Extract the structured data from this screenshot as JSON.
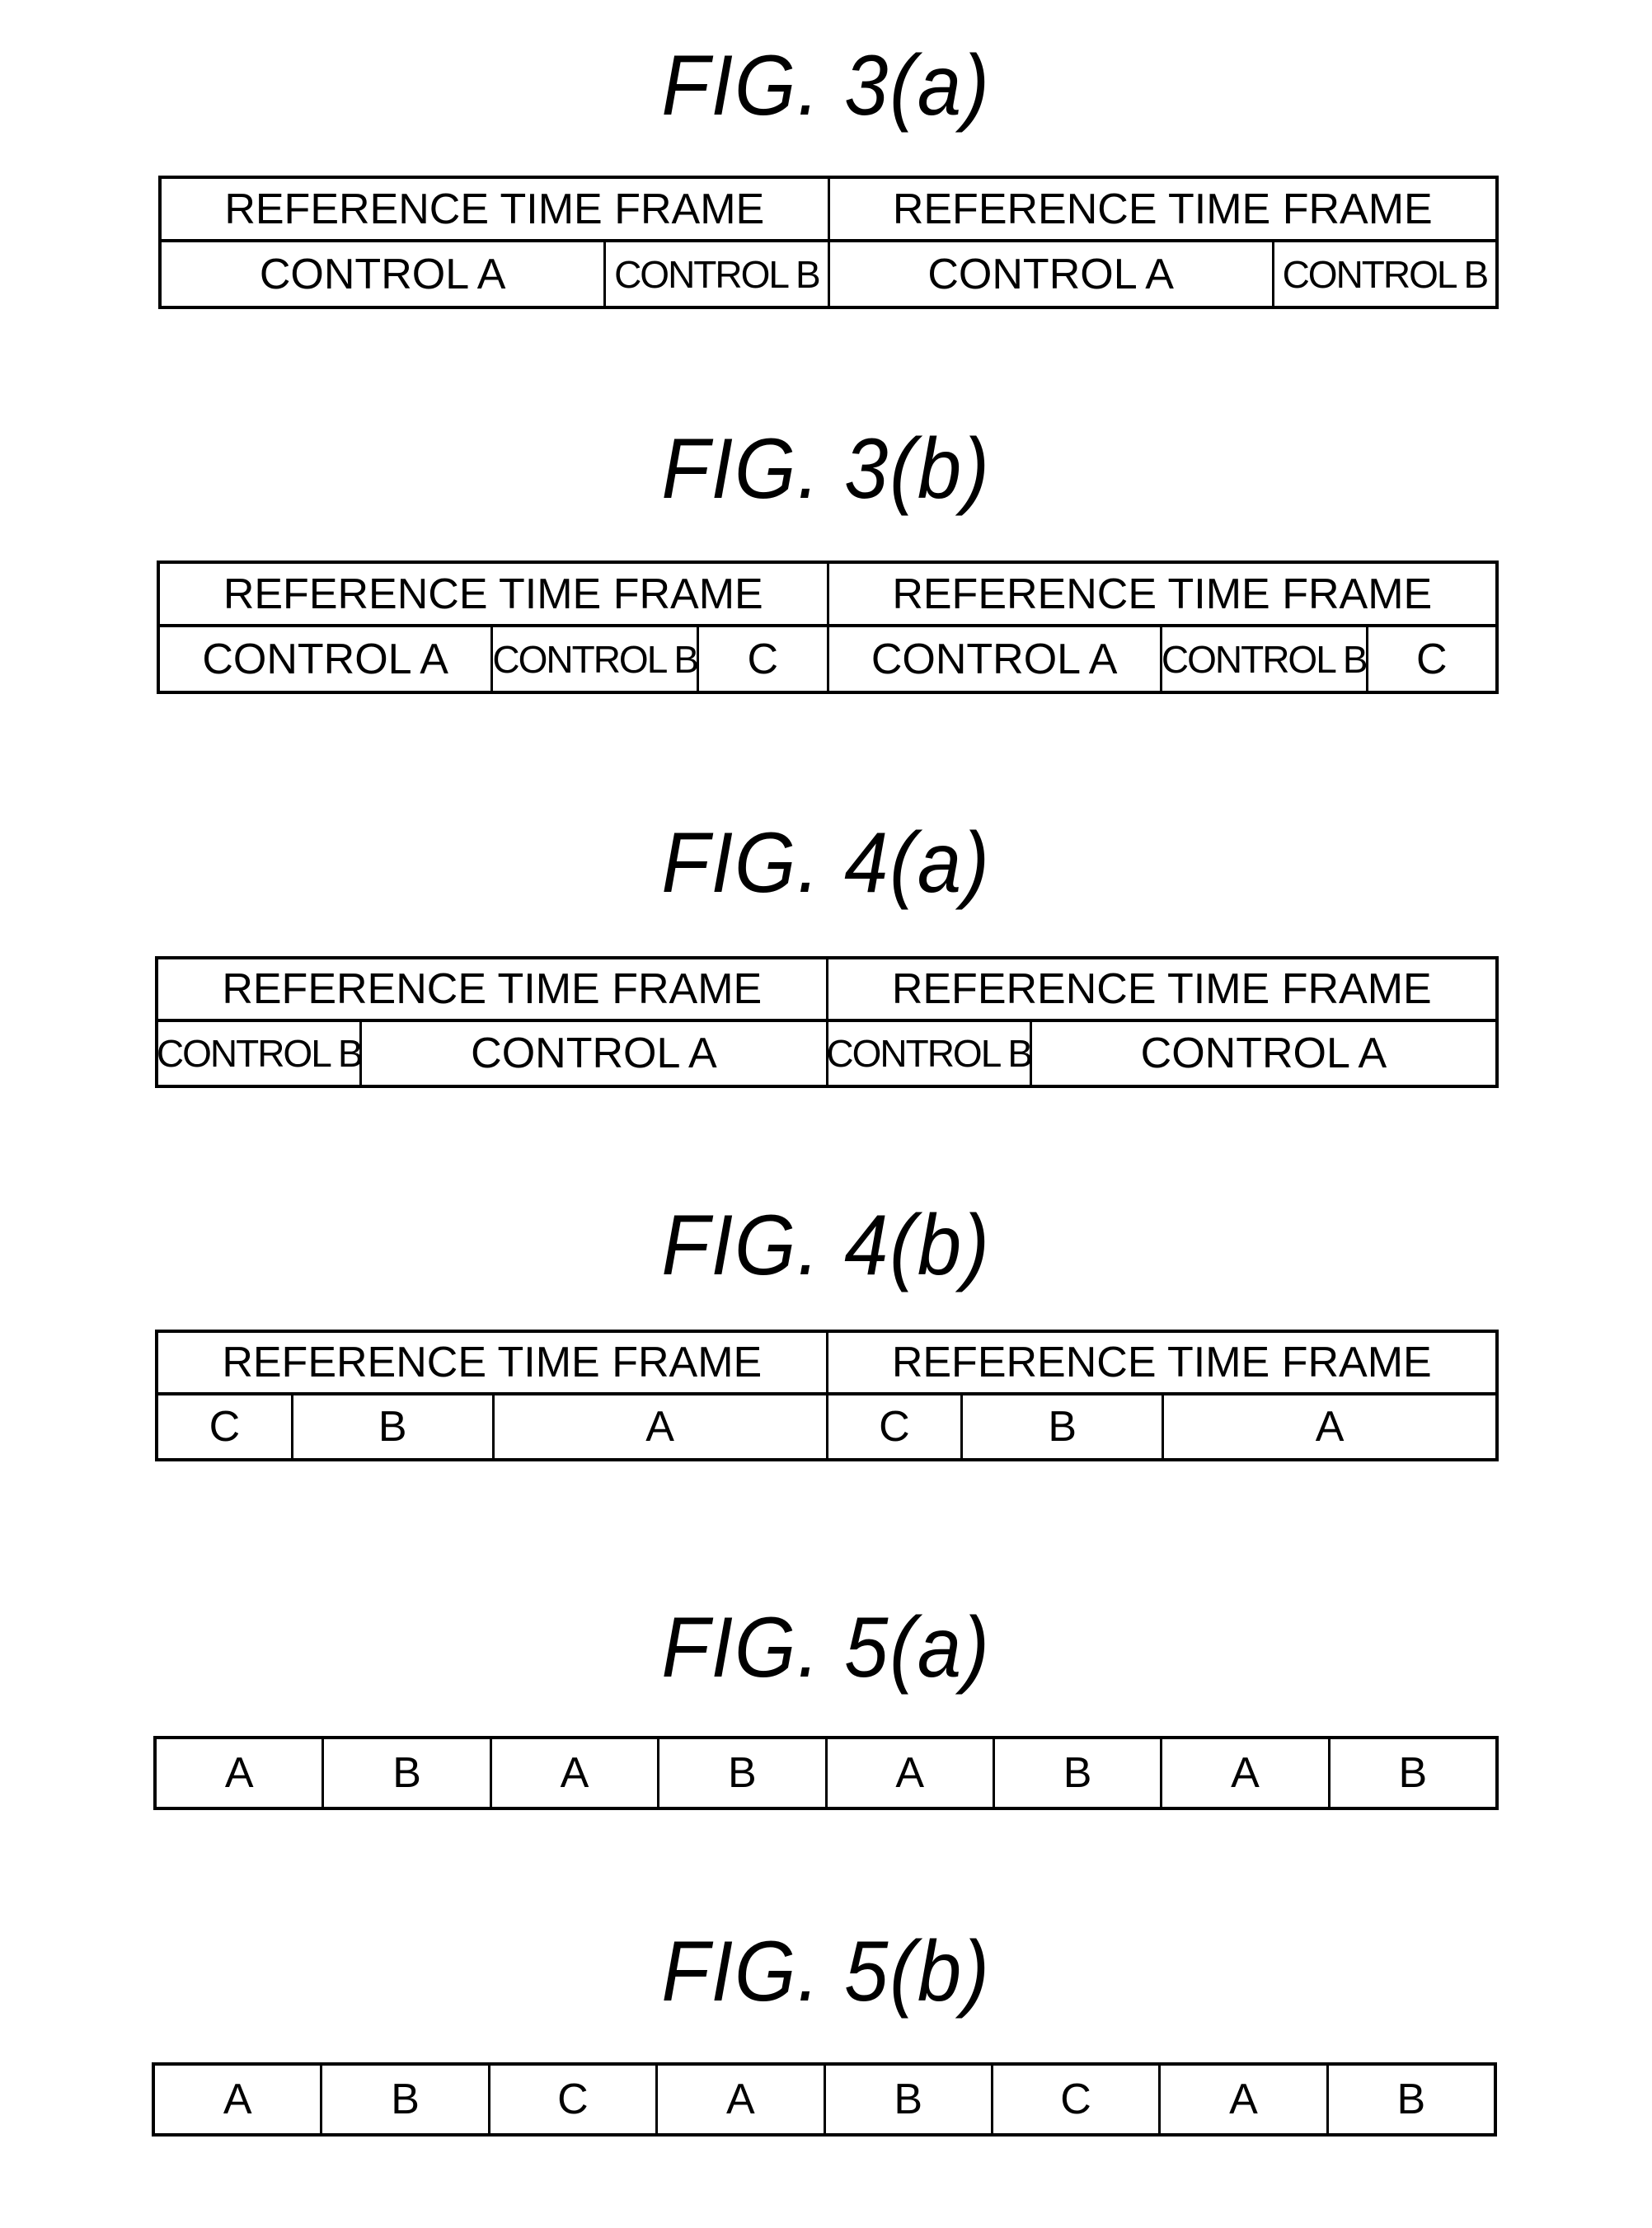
{
  "figures": [
    {
      "title": "FIG.  3(a)",
      "frames": [
        {
          "header": "REFERENCE TIME FRAME",
          "cells": [
            {
              "label": "CONTROL A",
              "w": 2
            },
            {
              "label": "CONTROL B",
              "w": 1
            }
          ]
        },
        {
          "header": "REFERENCE TIME FRAME",
          "cells": [
            {
              "label": "CONTROL A",
              "w": 2
            },
            {
              "label": "CONTROL B",
              "w": 1
            }
          ]
        }
      ]
    },
    {
      "title": "FIG.  3(b)",
      "frames": [
        {
          "header": "REFERENCE TIME FRAME",
          "cells": [
            {
              "label": "CONTROL A",
              "w": 2.6
            },
            {
              "label": "CONTROL B",
              "w": 1.6
            },
            {
              "label": "C",
              "w": 1
            }
          ]
        },
        {
          "header": "REFERENCE TIME FRAME",
          "cells": [
            {
              "label": "CONTROL A",
              "w": 2.6
            },
            {
              "label": "CONTROL B",
              "w": 1.6
            },
            {
              "label": "C",
              "w": 1
            }
          ]
        }
      ]
    },
    {
      "title": "FIG.  4(a)",
      "frames": [
        {
          "header": "REFERENCE TIME FRAME",
          "cells": [
            {
              "label": "CONTROL B",
              "w": 1
            },
            {
              "label": "CONTROL A",
              "w": 2.3
            }
          ]
        },
        {
          "header": "REFERENCE TIME FRAME",
          "cells": [
            {
              "label": "CONTROL B",
              "w": 1
            },
            {
              "label": "CONTROL A",
              "w": 2.3
            }
          ]
        }
      ]
    },
    {
      "title": "FIG.  4(b)",
      "frames": [
        {
          "header": "REFERENCE TIME FRAME",
          "cells": [
            {
              "label": "C",
              "w": 1
            },
            {
              "label": "B",
              "w": 1.5
            },
            {
              "label": "A",
              "w": 2.5
            }
          ]
        },
        {
          "header": "REFERENCE TIME FRAME",
          "cells": [
            {
              "label": "C",
              "w": 1
            },
            {
              "label": "B",
              "w": 1.5
            },
            {
              "label": "A",
              "w": 2.5
            }
          ]
        }
      ]
    },
    {
      "title": "FIG.  5(a)",
      "sequence": [
        "A",
        "B",
        "A",
        "B",
        "A",
        "B",
        "A",
        "B"
      ]
    },
    {
      "title": "FIG.  5(b)",
      "sequence": [
        "A",
        "B",
        "C",
        "A",
        "B",
        "C",
        "A",
        "B"
      ]
    }
  ]
}
